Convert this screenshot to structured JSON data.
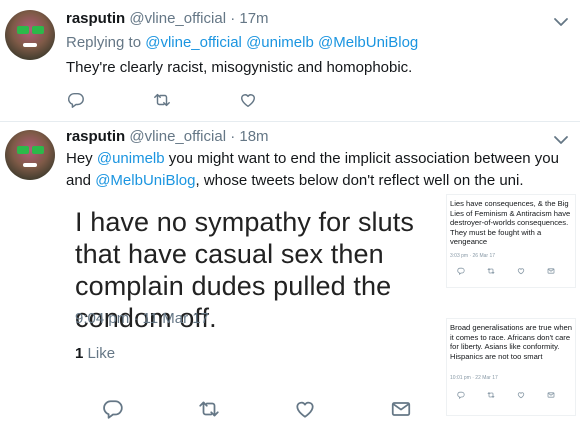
{
  "tweets": [
    {
      "author": {
        "name": "rasputin",
        "handle": "@vline_official"
      },
      "separator": "·",
      "time": "17m",
      "reply_prefix": "Replying to",
      "reply_to": [
        "@vline_official",
        "@unimelb",
        "@MelbUniBlog"
      ],
      "text": "They're clearly racist, misogynistic and homophobic."
    },
    {
      "author": {
        "name": "rasputin",
        "handle": "@vline_official"
      },
      "separator": "·",
      "time": "18m",
      "text_parts": {
        "p1": "Hey ",
        "m1": "@unimelb",
        "p2": " you might want to end the implicit association between you and ",
        "m2": "@MelbUniBlog",
        "p3": ", whose tweets below don't reflect well on the uni."
      },
      "embedded_tweet": {
        "text": "I have no sympathy for sluts that have casual sex then complain dudes pulled the condom off.",
        "timestamp": "9:04 pm · 11 Mar 17",
        "likes_count": "1",
        "likes_label": "Like"
      },
      "mini_tweets": [
        {
          "text": "Lies have consequences, & the Big Lies of Feminism & Antiracism have destroyer-of-worlds consequences. They must be fought with a vengeance",
          "time": "3:03 pm · 26 Mar 17"
        },
        {
          "text": "Broad generalisations are true when it comes to race. Africans don't care for liberty. Asians like conformity. Hispanics are not too smart",
          "time": "10:01 pm · 22 Mar 17"
        }
      ]
    }
  ],
  "icons": {
    "reply": "reply-icon",
    "retweet": "retweet-icon",
    "like": "heart-icon",
    "dm": "envelope-icon",
    "more": "chevron-down-icon"
  },
  "colors": {
    "link": "#1b95e0",
    "muted": "#657786",
    "divider": "#e6ecf0"
  }
}
